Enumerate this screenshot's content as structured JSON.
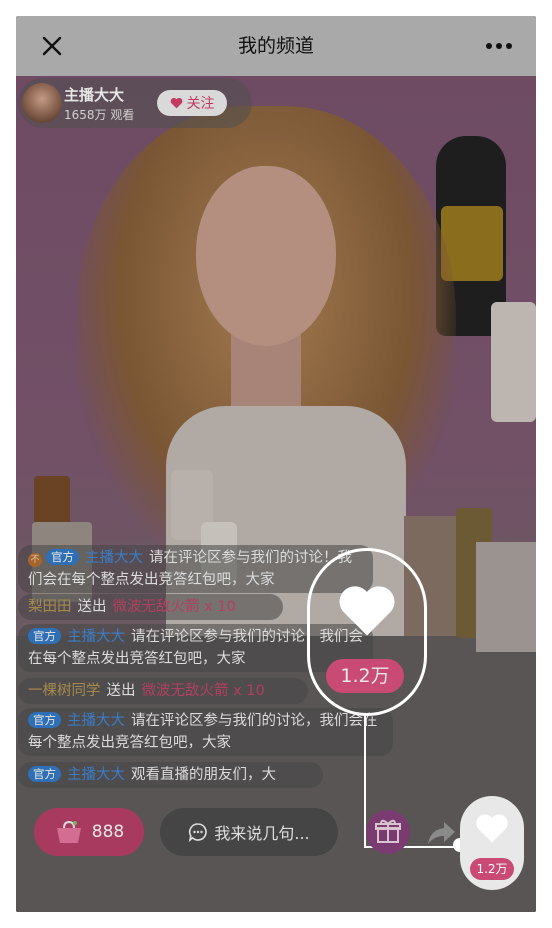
{
  "header": {
    "title": "我的频道",
    "close_icon": "close-icon",
    "more_icon": "more-horizontal-icon"
  },
  "host": {
    "name": "主播大大",
    "views": "1658万 观看",
    "follow_label": "关注"
  },
  "chat": [
    {
      "tag": "官方",
      "user": "主播大大",
      "text": "请在评论区参与我们的讨论！我们会在每个整点发出竞答红包吧，大家",
      "medal": "不"
    },
    {
      "user": "梨田田",
      "action": "送出",
      "gift": "微波无敌火箭 x 10"
    },
    {
      "tag": "官方",
      "user": "主播大大",
      "text": "请在评论区参与我们的讨论，我们会在每个整点发出竞答红包吧，大家"
    },
    {
      "user": "一棵树同学",
      "action": "送出",
      "gift": "微波无敌火箭 x 10"
    },
    {
      "tag": "官方",
      "user": "主播大大",
      "text": "请在评论区参与我们的讨论，我们会在每个整点发出竞答红包吧，大家"
    },
    {
      "tag": "官方",
      "user": "主播大大",
      "text": "观看直播的朋友们，大"
    }
  ],
  "likes": {
    "count_big": "1.2万",
    "count_small": "1.2万"
  },
  "bottom": {
    "cart_count": "888",
    "input_placeholder": "我来说几句..."
  },
  "colors": {
    "accent": "#c94a74",
    "official_tag": "#2f6fb6",
    "header_bg": "#a9a9a9"
  }
}
